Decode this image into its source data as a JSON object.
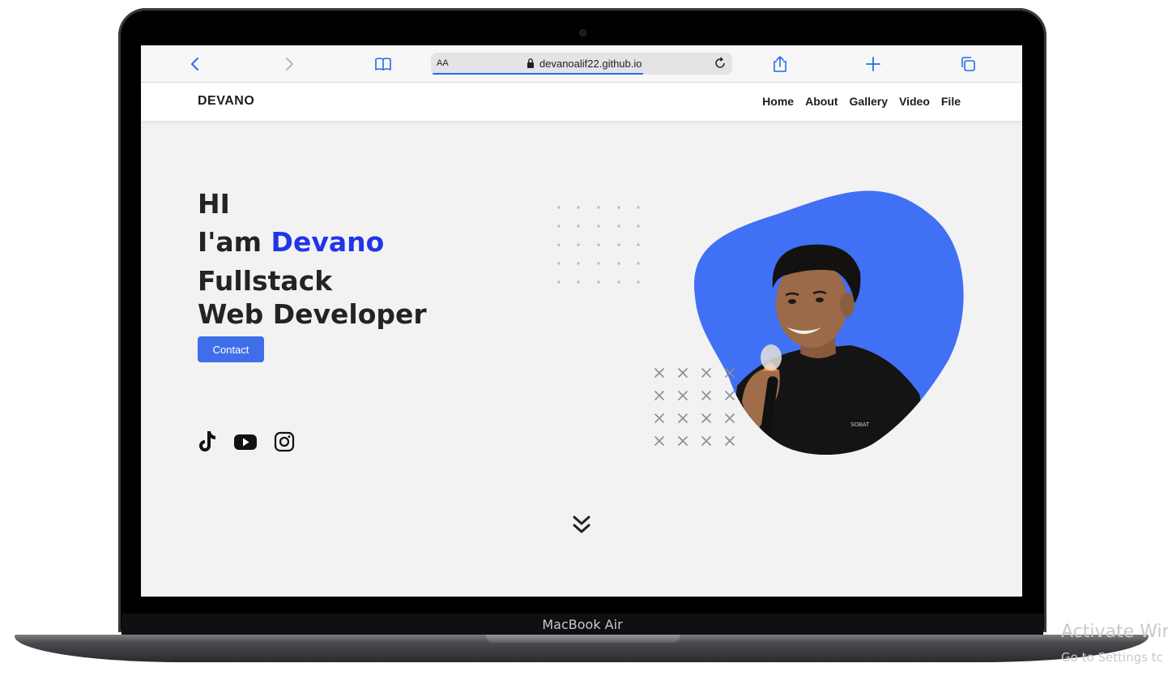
{
  "device": {
    "label": "MacBook Air"
  },
  "browser": {
    "text_size_label": "AA",
    "url": "devanoalif22.github.io",
    "load_progress_percent": 70,
    "accent_color": "#1f6fe8",
    "icons": [
      "back-icon",
      "forward-icon",
      "bookmarks-icon",
      "lock-icon",
      "reload-icon",
      "share-icon",
      "new-tab-icon",
      "tabs-icon"
    ]
  },
  "site": {
    "brand": "DEVANO",
    "nav": [
      "Home",
      "About",
      "Gallery",
      "Video",
      "File"
    ]
  },
  "hero": {
    "line1": "HI",
    "line2_prefix": "I'am",
    "line2_name": "Devano",
    "line3": "Fullstack",
    "line4": "Web Developer",
    "contact_label": "Contact",
    "accent_color": "#2135e8",
    "button_color": "#3f6fe8",
    "blob_color": "#4070f4",
    "socials": [
      "tiktok-icon",
      "youtube-icon",
      "instagram-icon"
    ]
  },
  "os_watermark": {
    "line1": "Activate Wir",
    "line2": "Go to Settings tc"
  }
}
